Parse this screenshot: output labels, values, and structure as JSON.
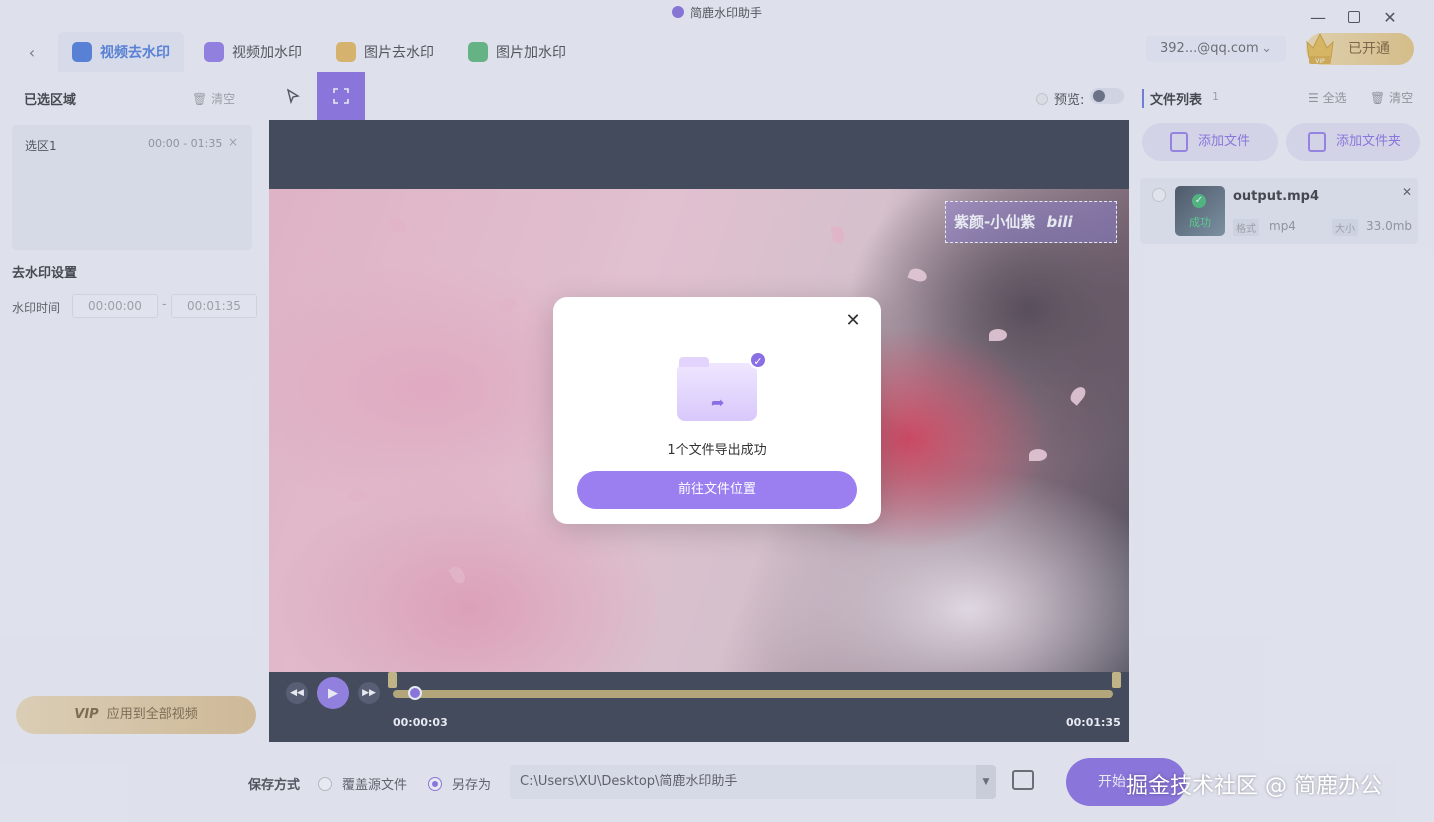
{
  "app": {
    "title": "简鹿水印助手"
  },
  "tabs": [
    {
      "label": "视频去水印",
      "active": true,
      "icon": "video-remove-icon",
      "color": "#3a6fd8"
    },
    {
      "label": "视频加水印",
      "active": false,
      "icon": "video-add-icon",
      "color": "#8a6ee6"
    },
    {
      "label": "图片去水印",
      "active": false,
      "icon": "image-remove-icon",
      "color": "#e7b54a"
    },
    {
      "label": "图片加水印",
      "active": false,
      "icon": "image-add-icon",
      "color": "#4cb36a"
    }
  ],
  "account": {
    "email": "392...@qq.com",
    "vip_label": "已开通",
    "vip_badge": "VIP"
  },
  "left": {
    "selected_title": "已选区域",
    "clear_label": "清空",
    "regions": [
      {
        "name": "选区1",
        "time": "00:00 - 01:35"
      }
    ],
    "settings_title": "去水印设置",
    "watermark_time_label": "水印时间",
    "time_start": "00:00:00",
    "time_end": "00:01:35",
    "dash": "-",
    "apply_vip_badge": "VIP",
    "apply_vip_label": "应用到全部视频"
  },
  "toolbar": {
    "preview_label": "预览:"
  },
  "video": {
    "watermark_text": "紫颜-小仙紫",
    "watermark_logo": "bili",
    "current_time": "00:00:03",
    "total_time": "00:01:35",
    "progress": 0.03
  },
  "right": {
    "title": "文件列表",
    "count": "1",
    "select_all": "全选",
    "clear": "清空",
    "add_file": "添加文件",
    "add_folder": "添加文件夹",
    "files": [
      {
        "name": "output.mp4",
        "status": "成功",
        "format_label": "格式",
        "format": "mp4",
        "size_label": "大小",
        "size": "33.0mb"
      }
    ]
  },
  "bottom": {
    "save_label": "保存方式",
    "overwrite": "覆盖源文件",
    "save_as": "另存为",
    "path": "C:\\Users\\XU\\Desktop\\简鹿水印助手",
    "start": "开始"
  },
  "credit": "掘金技术社区 @ 简鹿办公",
  "modal": {
    "message": "1个文件导出成功",
    "button": "前往文件位置"
  },
  "colors": {
    "accent": "#7e5fe0",
    "vip_gold": "#e6c271",
    "success": "#2fb463",
    "tab_active": "#3a6fd8"
  }
}
